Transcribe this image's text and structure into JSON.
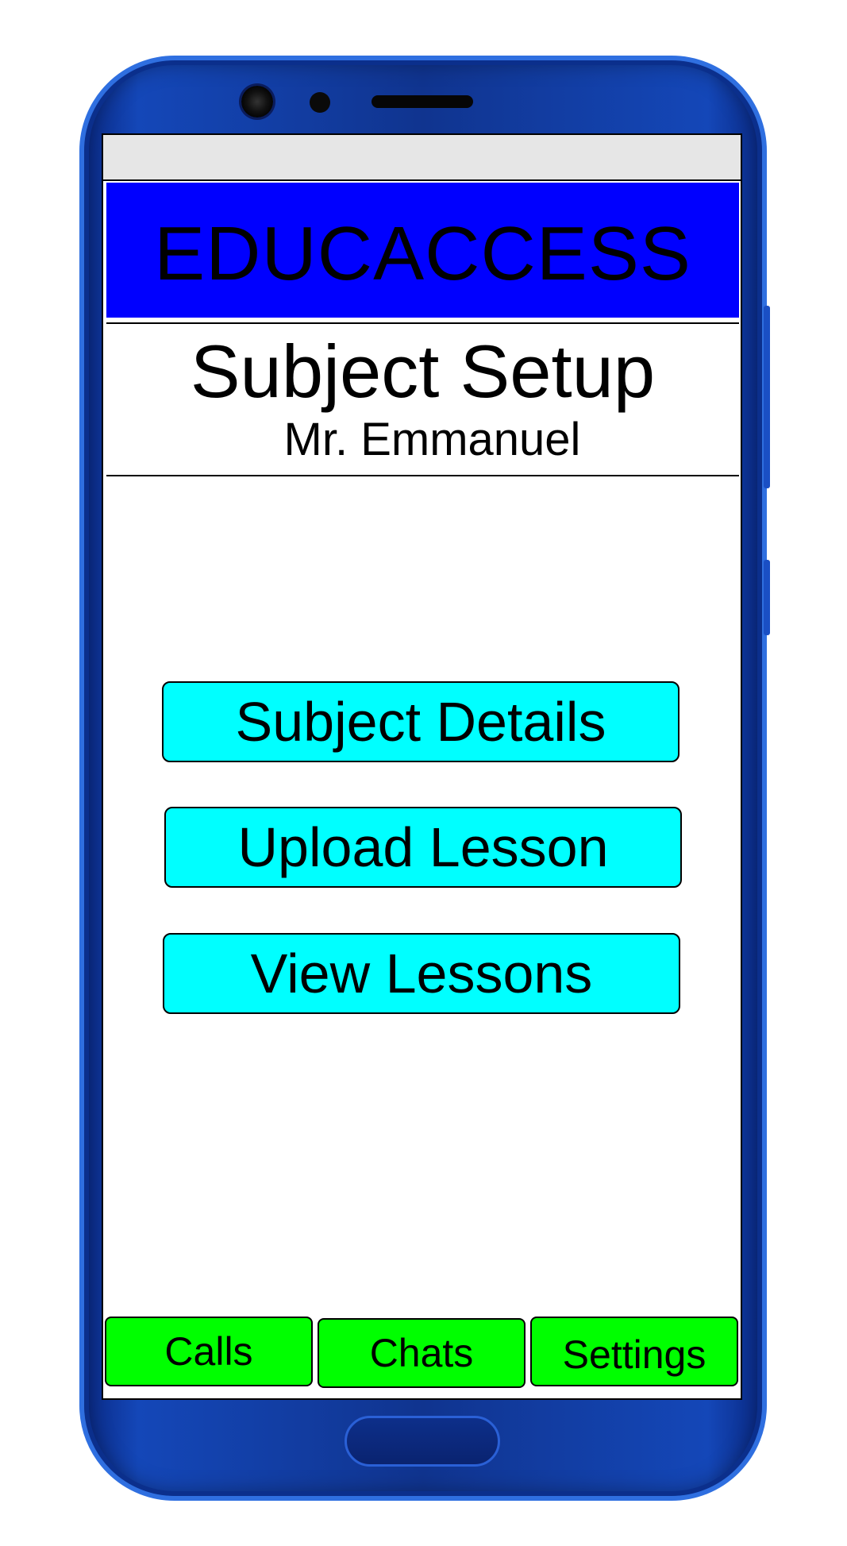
{
  "app": {
    "title": "EDUCACCESS"
  },
  "page": {
    "title": "Subject Setup",
    "teacher_name": "Mr. Emmanuel"
  },
  "menu": {
    "buttons": [
      {
        "label": "Subject Details"
      },
      {
        "label": "Upload Lesson"
      },
      {
        "label": "View Lessons"
      }
    ]
  },
  "tabs": [
    {
      "label": "Calls"
    },
    {
      "label": "Chats"
    },
    {
      "label": "Settings"
    }
  ],
  "colors": {
    "header": "#0000ff",
    "menu_button": "#00ffff",
    "tab": "#00ff00",
    "phone_frame": "#1447b8"
  }
}
